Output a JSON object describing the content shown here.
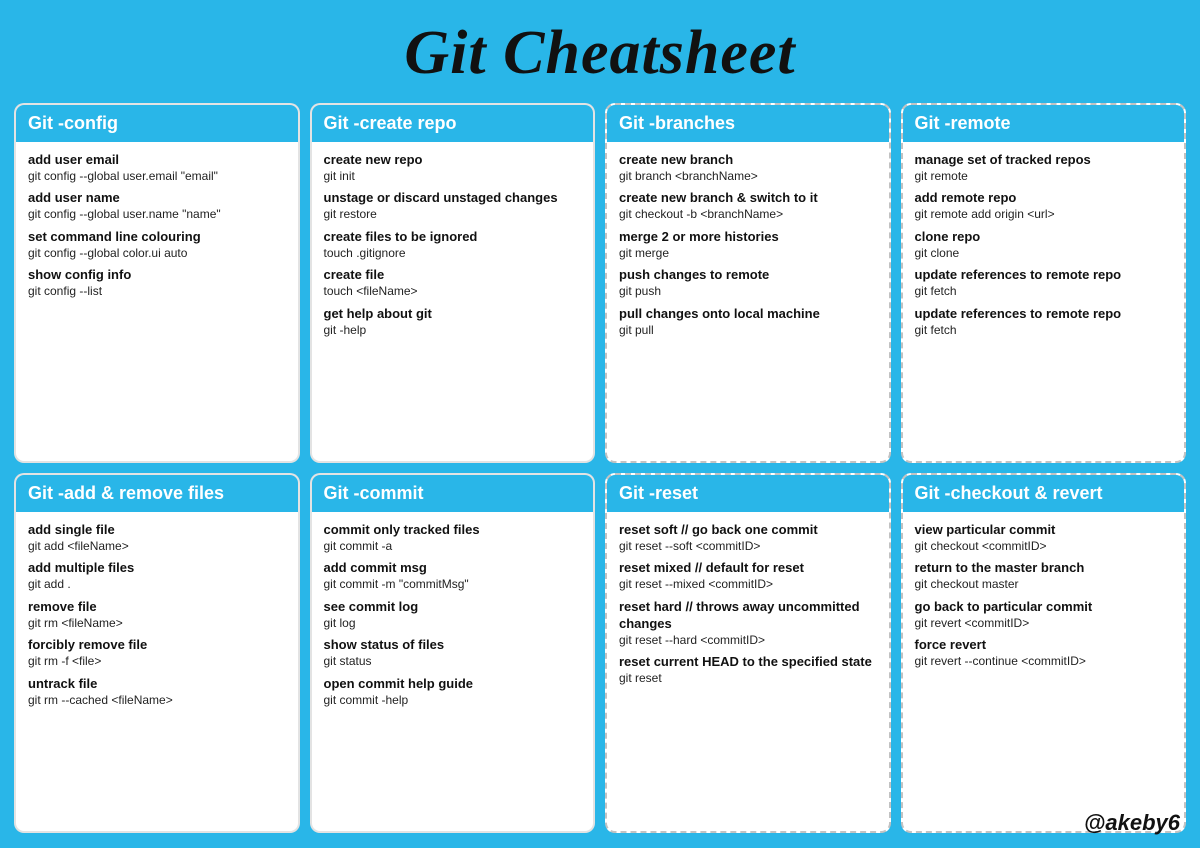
{
  "title": "Git Cheatsheet",
  "watermark": "@akebу6",
  "cards": [
    {
      "id": "config",
      "header": "Git -config",
      "commands": [
        {
          "label": "add user email",
          "code": "git config --global user.email \"email\""
        },
        {
          "label": "add user name",
          "code": "git config --global user.name \"name\""
        },
        {
          "label": "set command line colouring",
          "code": "git config --global color.ui auto"
        },
        {
          "label": "show config info",
          "code": "git config --list"
        }
      ]
    },
    {
      "id": "create-repo",
      "header": "Git -create repo",
      "commands": [
        {
          "label": "create new repo",
          "code": "git init"
        },
        {
          "label": "unstage or discard unstaged changes",
          "code": "git restore"
        },
        {
          "label": "create files to be ignored",
          "code": "touch .gitignore"
        },
        {
          "label": "create file",
          "code": "touch <fileName>"
        },
        {
          "label": "get help about git",
          "code": "git -help"
        }
      ]
    },
    {
      "id": "branches",
      "header": "Git -branches",
      "commands": [
        {
          "label": "create new branch",
          "code": "git branch <branchName>"
        },
        {
          "label": "create new branch & switch to it",
          "code": "git checkout -b <branchName>"
        },
        {
          "label": "merge 2 or more histories",
          "code": "git merge"
        },
        {
          "label": "push changes to remote",
          "code": "git push"
        },
        {
          "label": "pull changes onto local machine",
          "code": "git pull"
        }
      ]
    },
    {
      "id": "remote",
      "header": "Git -remote",
      "commands": [
        {
          "label": "manage set of tracked repos",
          "code": "git remote"
        },
        {
          "label": "add remote repo",
          "code": "git remote add origin <url>"
        },
        {
          "label": "clone repo",
          "code": "git clone"
        },
        {
          "label": "update references to remote repo",
          "code": "git fetch"
        },
        {
          "label": "update references to remote repo",
          "code": "git fetch"
        }
      ]
    },
    {
      "id": "add-remove",
      "header": "Git -add & remove files",
      "commands": [
        {
          "label": "add single file",
          "code": "git add <fileName>"
        },
        {
          "label": "add multiple files",
          "code": "git add ."
        },
        {
          "label": "remove file",
          "code": "git rm <fileName>"
        },
        {
          "label": "forcibly remove file",
          "code": "git rm -f <file>"
        },
        {
          "label": "untrack file",
          "code": "git rm --cached <fileName>"
        }
      ]
    },
    {
      "id": "commit",
      "header": "Git -commit",
      "commands": [
        {
          "label": "commit only tracked files",
          "code": "git commit -a"
        },
        {
          "label": "add commit msg",
          "code": "git commit -m \"commitMsg\""
        },
        {
          "label": "see commit log",
          "code": "git log"
        },
        {
          "label": "show status of files",
          "code": "git status"
        },
        {
          "label": "open commit help guide",
          "code": "git commit -help"
        }
      ]
    },
    {
      "id": "reset",
      "header": "Git -reset",
      "commands": [
        {
          "label": "reset soft // go back one commit",
          "code": "git reset --soft <commitID>"
        },
        {
          "label": "reset mixed // default for reset",
          "code": "git reset --mixed <commitID>"
        },
        {
          "label": "reset hard // throws away uncommitted changes",
          "code": "git reset --hard <commitID>"
        },
        {
          "label": "reset current HEAD to the specified state",
          "code": "git reset"
        }
      ]
    },
    {
      "id": "checkout-revert",
      "header": "Git -checkout & revert",
      "commands": [
        {
          "label": "view particular commit",
          "code": "git checkout <commitID>"
        },
        {
          "label": "return to the master branch",
          "code": "git checkout master"
        },
        {
          "label": "go back to particular commit",
          "code": "git revert <commitID>"
        },
        {
          "label": "force revert",
          "code": "git revert --continue <commitID>"
        }
      ]
    }
  ]
}
